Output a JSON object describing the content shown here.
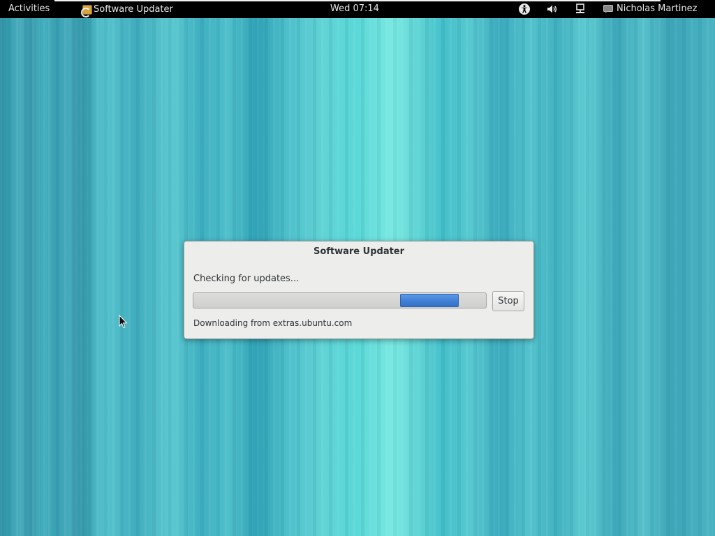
{
  "topbar": {
    "activities": "Activities",
    "app_menu": "Software Updater",
    "clock": "Wed 07:14",
    "user_name": "Nicholas Martinez",
    "icons": [
      "accessibility-icon",
      "volume-icon",
      "network-icon",
      "chat-status-icon"
    ]
  },
  "dialog": {
    "title": "Software Updater",
    "status": "Checking for updates...",
    "progress": "indeterminate",
    "stop_label": "Stop",
    "detail": "Downloading from extras.ubuntu.com"
  },
  "colors": {
    "topbar_bg": "#000000",
    "progress_accent": "#3f7fd6",
    "desktop_teal": "#3fb8c4"
  }
}
